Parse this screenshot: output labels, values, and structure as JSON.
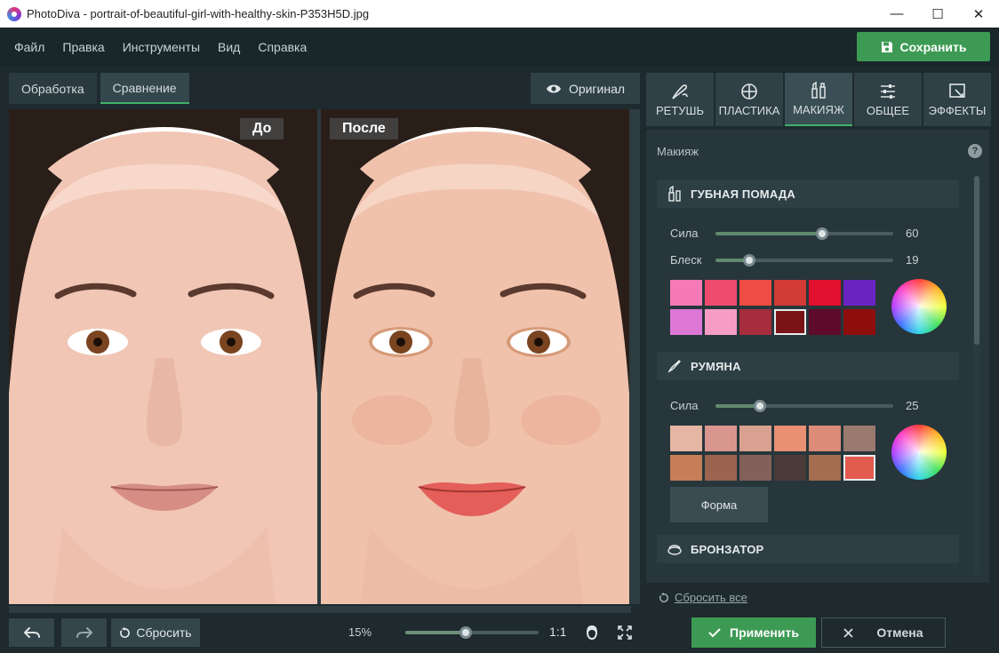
{
  "window": {
    "title": "PhotoDiva - portrait-of-beautiful-girl-with-healthy-skin-P353H5D.jpg",
    "minimize": "—",
    "maximize": "☐",
    "close": "✕"
  },
  "menu": {
    "items": [
      "Файл",
      "Правка",
      "Инструменты",
      "Вид",
      "Справка"
    ],
    "save_label": "Сохранить"
  },
  "view_tabs": {
    "items": [
      "Обработка",
      "Сравнение"
    ],
    "active": "Сравнение",
    "original_label": "Оригинал"
  },
  "compare": {
    "before_label": "До",
    "after_label": "После"
  },
  "bottom_bar": {
    "reset_label": "Сбросить",
    "zoom_percent": "15%",
    "zoom_level": 0.45,
    "one_to_one": "1:1"
  },
  "panel_tabs": {
    "items": [
      "РЕТУШЬ",
      "ПЛАСТИКА",
      "МАКИЯЖ",
      "ОБЩЕЕ",
      "ЭФФЕКТЫ"
    ],
    "active": "МАКИЯЖ"
  },
  "makeup": {
    "heading": "Макияж",
    "help": "?",
    "lipstick": {
      "title": "ГУБНАЯ ПОМАДА",
      "strength_label": "Сила",
      "strength_value": "60",
      "strength": 60,
      "gloss_label": "Блеск",
      "gloss_value": "19",
      "gloss": 19,
      "swatches": [
        "#f57ab6",
        "#ee4c6e",
        "#ef4c43",
        "#d23a36",
        "#e0102e",
        "#6a24c2",
        "#dc77d6",
        "#f79cc6",
        "#a52d3c",
        "#7a1318",
        "#5e0b2b",
        "#8e0e0e"
      ],
      "selected_index": 9
    },
    "blush": {
      "title": "РУМЯНА",
      "strength_label": "Сила",
      "strength_value": "25",
      "strength": 25,
      "swatches": [
        "#e5b6a3",
        "#d9968f",
        "#d8a190",
        "#e88f74",
        "#db8b78",
        "#9a7a6e",
        "#c77e56",
        "#9a6450",
        "#83605a",
        "#4a3a3a",
        "#a46d4f",
        "#e35a4f"
      ],
      "selected_index": 11,
      "shape_label": "Форма"
    },
    "bronzer": {
      "title": "БРОНЗАТОР"
    },
    "reset_all_label": "Сбросить все"
  },
  "footer": {
    "apply_label": "Применить",
    "cancel_label": "Отмена"
  },
  "colors": {
    "accent_green": "#3d9a54",
    "background": "#1e2a2e",
    "panel": "#26363b"
  }
}
